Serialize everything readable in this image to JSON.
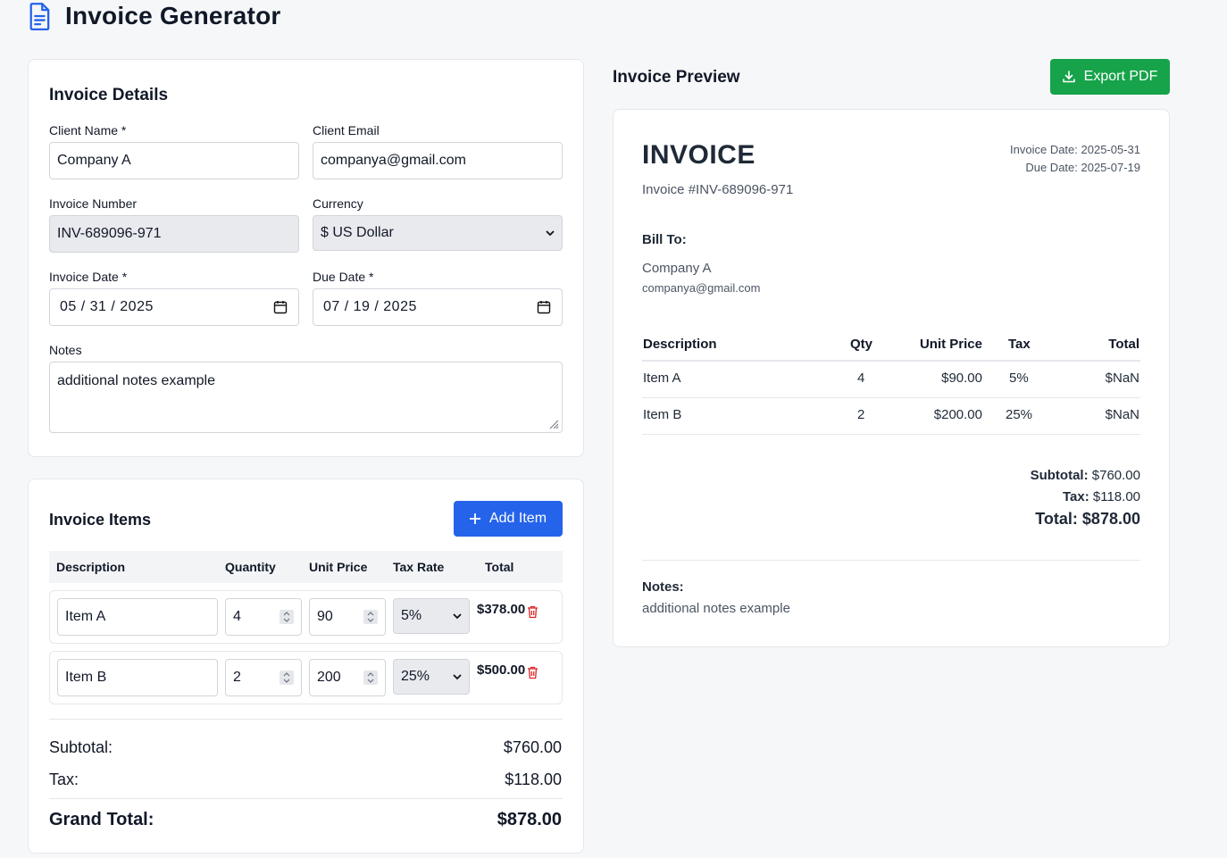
{
  "app": {
    "title": "Invoice Generator",
    "icon": "document-icon"
  },
  "details": {
    "title": "Invoice Details",
    "client_name": {
      "label": "Client Name *",
      "value": "Company A"
    },
    "client_email": {
      "label": "Client Email",
      "value": "companya@gmail.com"
    },
    "invoice_number": {
      "label": "Invoice Number",
      "value": "INV-689096-971"
    },
    "currency": {
      "label": "Currency",
      "value": "$ US Dollar"
    },
    "invoice_date": {
      "label": "Invoice Date *",
      "value": "05 / 31 / 2025"
    },
    "due_date": {
      "label": "Due Date *",
      "value": "07 / 19 / 2025"
    },
    "notes": {
      "label": "Notes",
      "value": "additional notes example"
    }
  },
  "items": {
    "title": "Invoice Items",
    "add_label": "Add Item",
    "headers": [
      "Description",
      "Quantity",
      "Unit Price",
      "Tax Rate",
      "Total"
    ],
    "rows": [
      {
        "description": "Item A",
        "quantity": "4",
        "unit_price": "90",
        "tax_rate": "5%",
        "total": "$378.00"
      },
      {
        "description": "Item B",
        "quantity": "2",
        "unit_price": "200",
        "tax_rate": "25%",
        "total": "$500.00"
      }
    ],
    "subtotal_label": "Subtotal:",
    "subtotal": "$760.00",
    "tax_label": "Tax:",
    "tax": "$118.00",
    "grand_label": "Grand Total:",
    "grand": "$878.00"
  },
  "preview": {
    "heading": "Invoice Preview",
    "export_label": "Export PDF",
    "invoice_word": "INVOICE",
    "invoice_number": "Invoice #INV-689096-971",
    "invoice_date": "Invoice Date: 2025-05-31",
    "due_date": "Due Date: 2025-07-19",
    "bill_to": "Bill To:",
    "client_name": "Company A",
    "client_email": "companya@gmail.com",
    "headers": [
      "Description",
      "Qty",
      "Unit Price",
      "Tax",
      "Total"
    ],
    "rows": [
      {
        "description": "Item A",
        "qty": "4",
        "unit_price": "$90.00",
        "tax": "5%",
        "total": "$NaN"
      },
      {
        "description": "Item B",
        "qty": "2",
        "unit_price": "$200.00",
        "tax": "25%",
        "total": "$NaN"
      }
    ],
    "subtotal_label": "Subtotal:",
    "subtotal": "$760.00",
    "tax_label": "Tax:",
    "tax": "$118.00",
    "total_label": "Total:",
    "total": "$878.00",
    "notes_label": "Notes:",
    "notes": "additional notes example"
  },
  "colors": {
    "primary": "#2563eb",
    "export": "#16a34a",
    "delete": "#dc2626"
  }
}
